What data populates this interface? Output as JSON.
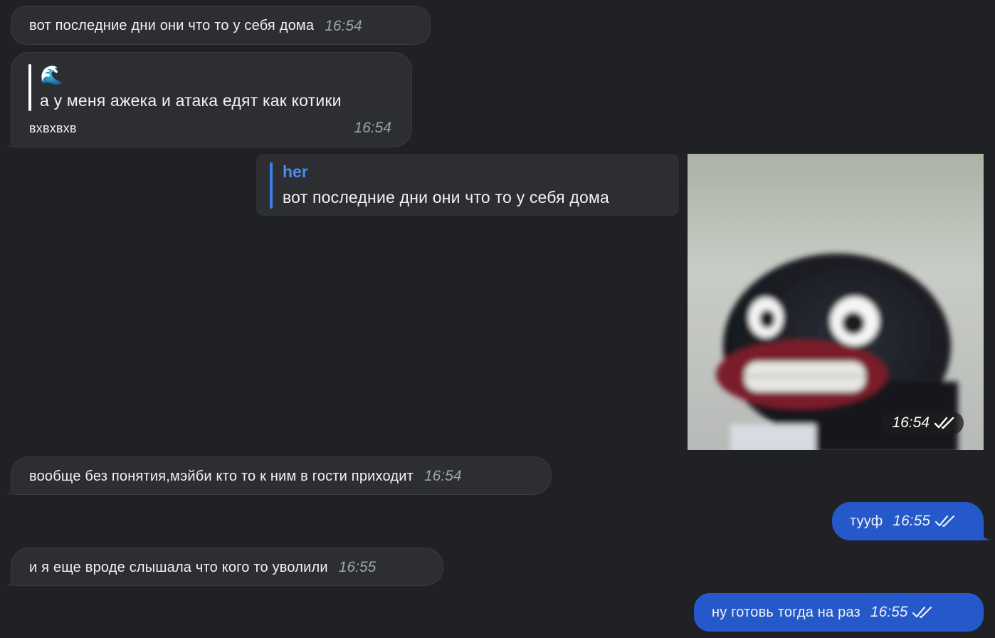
{
  "colors": {
    "background": "#1f2124",
    "incoming_bubble": "#2c2e31",
    "outgoing_bubble": "#2559c9",
    "reply_accent": "#3b7ee8",
    "reply_name": "#4a8df0"
  },
  "messages": [
    {
      "text": "вот последние дни они что то у себя дома",
      "time": "16:54"
    },
    {
      "quote_icon": "🌊",
      "quote_text": "а у меня ажека и атака едят как котики",
      "text": "вхвхвхв",
      "time": "16:54"
    },
    {
      "reply_name": "her",
      "reply_text": "вот последние дни они что то у себя дома"
    },
    {
      "photo_icon": "sticker-photo",
      "time": "16:54"
    },
    {
      "text": "вообще без понятия,мэйби кто то к ним в гости приходит",
      "time": "16:54"
    },
    {
      "text": "тууф",
      "time": "16:55"
    },
    {
      "text": "и я еще вроде слышала что кого то уволили",
      "time": "16:55"
    },
    {
      "text": "ну готовь тогда на раз",
      "time": "16:55"
    }
  ]
}
